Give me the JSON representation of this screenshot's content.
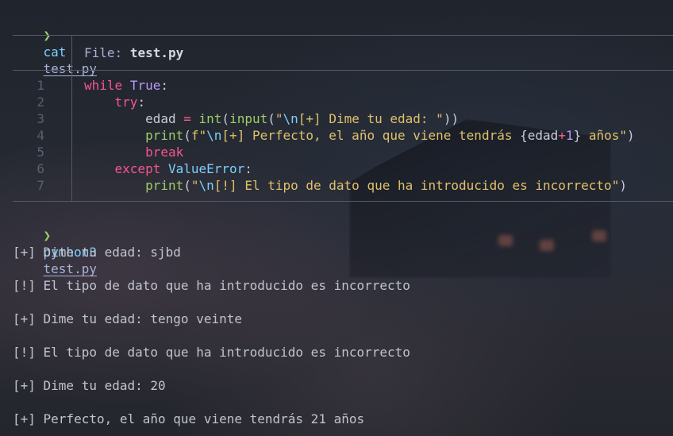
{
  "terminal": {
    "prompt_symbol": "❯",
    "cmd1": {
      "command": "cat",
      "argument": "test.py"
    },
    "file_header": {
      "label": "File:",
      "filename": "test.py"
    },
    "code_lines": [
      {
        "num": "1",
        "text": "while True:"
      },
      {
        "num": "2",
        "text": "    try:"
      },
      {
        "num": "3",
        "text": "        edad = int(input(\"\\n[+] Dime tu edad: \"))"
      },
      {
        "num": "4",
        "text": "        print(f\"\\n[+] Perfecto, el año que viene tendrás {edad+1} años\")"
      },
      {
        "num": "5",
        "text": "        break"
      },
      {
        "num": "6",
        "text": "    except ValueError:"
      },
      {
        "num": "7",
        "text": "        print(\"\\n[!] El tipo de dato que ha introducido es incorrecto\")"
      }
    ],
    "cmd2": {
      "command": "python3",
      "argument": "test.py"
    },
    "output_lines": [
      "[+] Dime tu edad: sjbd",
      "[!] El tipo de dato que ha introducido es incorrecto",
      "[+] Dime tu edad: tengo veinte",
      "[!] El tipo de dato que ha introducido es incorrecto",
      "[+] Dime tu edad: 20",
      "[+] Perfecto, el año que viene tendrás 21 años"
    ]
  },
  "colors": {
    "prompt": "#9ece6a",
    "command": "#7dcfff",
    "keyword": "#f7568f",
    "string": "#e0c06a",
    "builtin": "#9ece6a",
    "escape": "#7dcfff",
    "constant": "#bb9af7"
  }
}
